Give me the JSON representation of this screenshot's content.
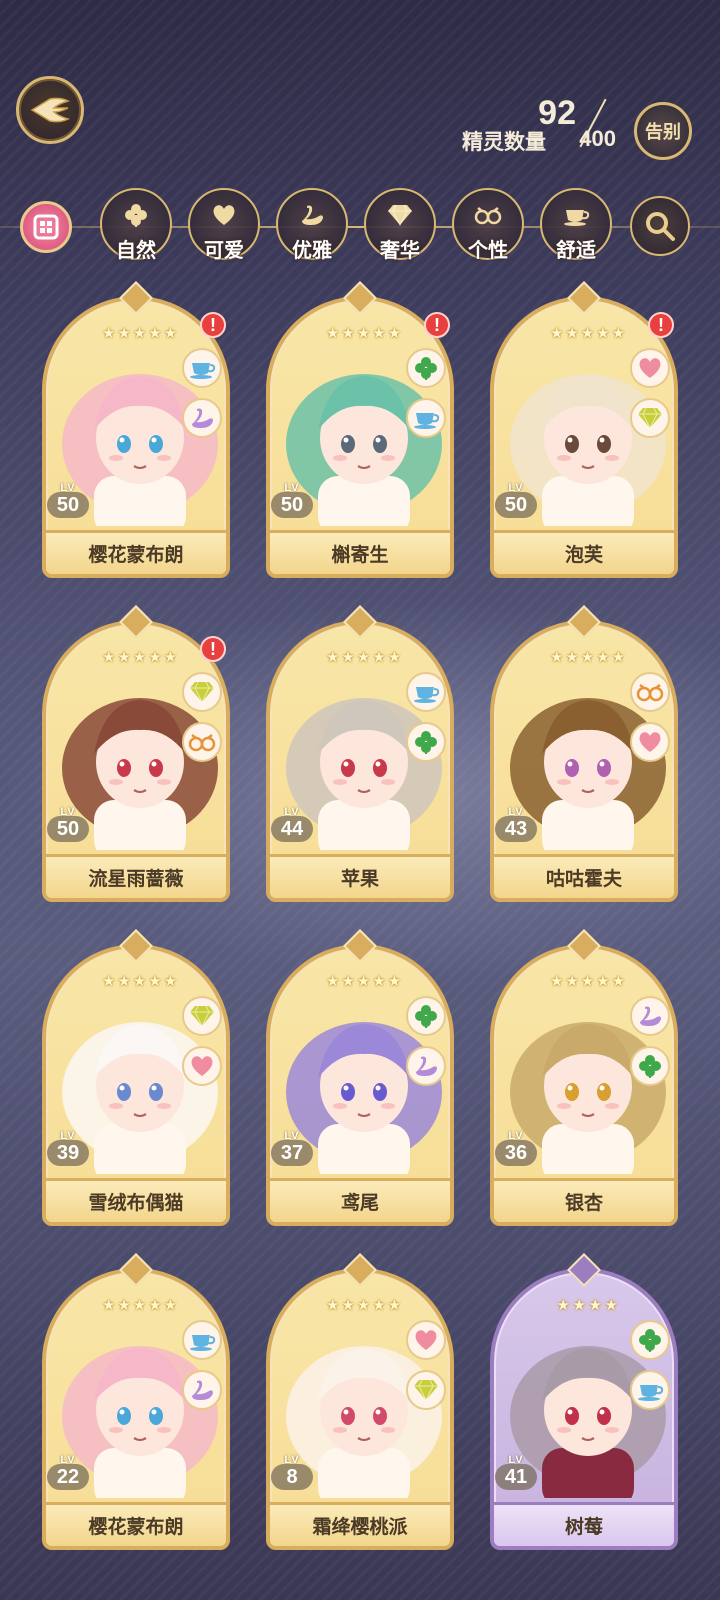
{
  "header": {
    "back_icon": "wing-back-icon",
    "count_current": "92",
    "count_label": "精灵数量",
    "count_total": "400",
    "farewell_label": "告别"
  },
  "filters": {
    "gift_icon": "gift-box-icon",
    "items": [
      {
        "label": "自然",
        "icon": "clover-icon"
      },
      {
        "label": "可爱",
        "icon": "heart-icon"
      },
      {
        "label": "优雅",
        "icon": "swan-icon"
      },
      {
        "label": "奢华",
        "icon": "diamond-icon"
      },
      {
        "label": "个性",
        "icon": "glasses-icon"
      },
      {
        "label": "舒适",
        "icon": "teacup-icon"
      }
    ],
    "search_icon": "search-icon"
  },
  "cards": [
    {
      "name": "樱花蒙布朗",
      "level": "50",
      "stars": 5,
      "alert": true,
      "traits": [
        "teacup",
        "swan"
      ],
      "hair": "#f6b8c8",
      "skin": "#fde6dc"
    },
    {
      "name": "槲寄生",
      "level": "50",
      "stars": 5,
      "alert": true,
      "traits": [
        "clover",
        "teacup"
      ],
      "hair": "#6cc2a8",
      "skin": "#fde6dc"
    },
    {
      "name": "泡芙",
      "level": "50",
      "stars": 5,
      "alert": true,
      "traits": [
        "heart",
        "diamond"
      ],
      "hair": "#f1e4cc",
      "skin": "#fde6dc"
    },
    {
      "name": "流星雨蔷薇",
      "level": "50",
      "stars": 5,
      "alert": true,
      "traits": [
        "diamond",
        "glasses"
      ],
      "hair": "#8a4a3a",
      "skin": "#fde6dc"
    },
    {
      "name": "苹果",
      "level": "44",
      "stars": 5,
      "alert": false,
      "traits": [
        "teacup",
        "clover"
      ],
      "hair": "#cfc6bc",
      "skin": "#fde6dc"
    },
    {
      "name": "咕咕霍夫",
      "level": "43",
      "stars": 5,
      "alert": false,
      "traits": [
        "glasses",
        "heart"
      ],
      "hair": "#8a6030",
      "skin": "#fde6dc"
    },
    {
      "name": "雪绒布偶猫",
      "level": "39",
      "stars": 5,
      "alert": false,
      "traits": [
        "diamond",
        "heart"
      ],
      "hair": "#fbf7f4",
      "skin": "#fde6dc"
    },
    {
      "name": "鸢尾",
      "level": "37",
      "stars": 5,
      "alert": false,
      "traits": [
        "clover",
        "swan"
      ],
      "hair": "#9c88d8",
      "skin": "#fde6dc"
    },
    {
      "name": "银杏",
      "level": "36",
      "stars": 5,
      "alert": false,
      "traits": [
        "swan",
        "clover"
      ],
      "hair": "#c9aa6a",
      "skin": "#fde6dc"
    },
    {
      "name": "樱花蒙布朗",
      "level": "22",
      "stars": 5,
      "alert": false,
      "traits": [
        "teacup",
        "swan"
      ],
      "hair": "#f6b8c8",
      "skin": "#fde6dc"
    },
    {
      "name": "霜绛樱桃派",
      "level": "8",
      "stars": 5,
      "alert": false,
      "traits": [
        "heart",
        "diamond"
      ],
      "hair": "#fbf2ea",
      "skin": "#fde6dc"
    },
    {
      "name": "树莓",
      "level": "41",
      "stars": 4,
      "alert": false,
      "traits": [
        "clover",
        "teacup"
      ],
      "hair": "#a99aa8",
      "skin": "#fde6dc",
      "purple": true
    }
  ],
  "lv_tag": "LV",
  "colors": {
    "gold": "#d9ad5e",
    "card_bg": "#f7dd95",
    "purple_frame": "#9b7dc0",
    "alert": "#e8403f"
  }
}
